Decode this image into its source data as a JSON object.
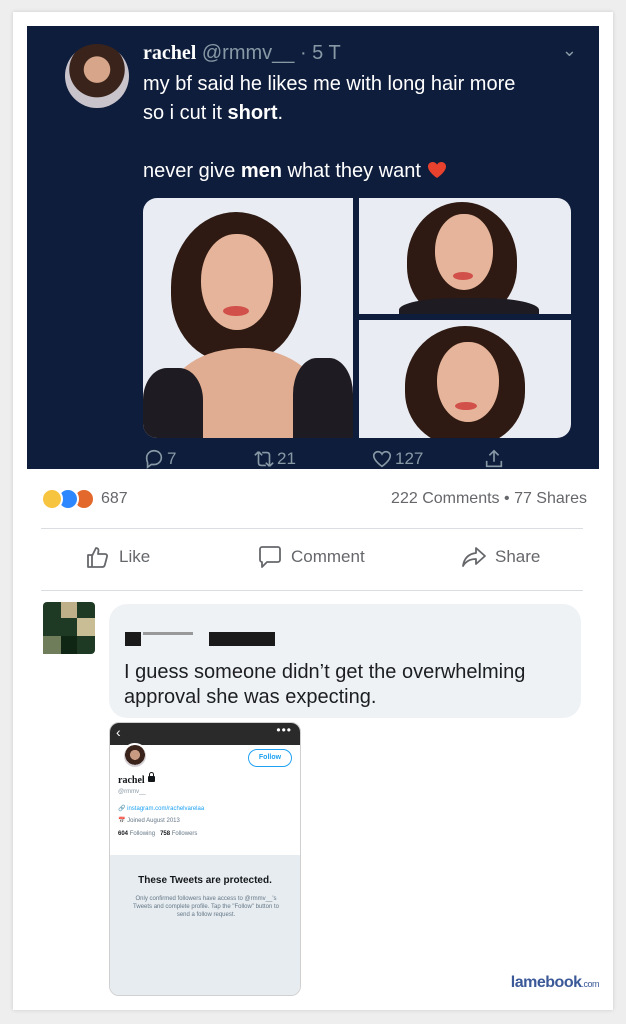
{
  "tweet": {
    "name": "rachel",
    "handle": "@rmmv__",
    "time": "· 5 T",
    "line1": "my bf said he likes me with long hair more",
    "line2_start": "so i cut it ",
    "line2_bold": "short",
    "line2_end": ".",
    "line3_start": "never give ",
    "line3_bold": "men",
    "line3_end": " what they want",
    "replies": "7",
    "retweets": "21",
    "likes": "127"
  },
  "post": {
    "reaction_count": "687",
    "comments": "222 Comments",
    "separator": "•",
    "shares": "77 Shares",
    "like_label": "Like",
    "comment_label": "Comment",
    "share_label": "Share"
  },
  "comment": {
    "text": "I guess someone didn’t get the overwhelming approval she was expecting."
  },
  "profile_shot": {
    "follow_label": "Follow",
    "name": "rachel",
    "handle": "@rmmv__",
    "link": "instagram.com/rachelvarelaa",
    "joined": "Joined August 2013",
    "following_count": "604",
    "following_label": "Following",
    "followers_count": "758",
    "followers_label": "Followers",
    "protected_title": "These Tweets are protected.",
    "protected_body": "Only confirmed followers have access to @rmmv__'s Tweets and complete profile. Tap the \"Follow\" button to send a follow request."
  },
  "watermark": {
    "brand": "lamebook",
    "tld": ".com"
  },
  "colors": {
    "tweet_bg": "#0f1d3c",
    "twitter_blue": "#1da1f2",
    "fb_gray": "#65676b",
    "bubble_bg": "#eff2f5"
  }
}
